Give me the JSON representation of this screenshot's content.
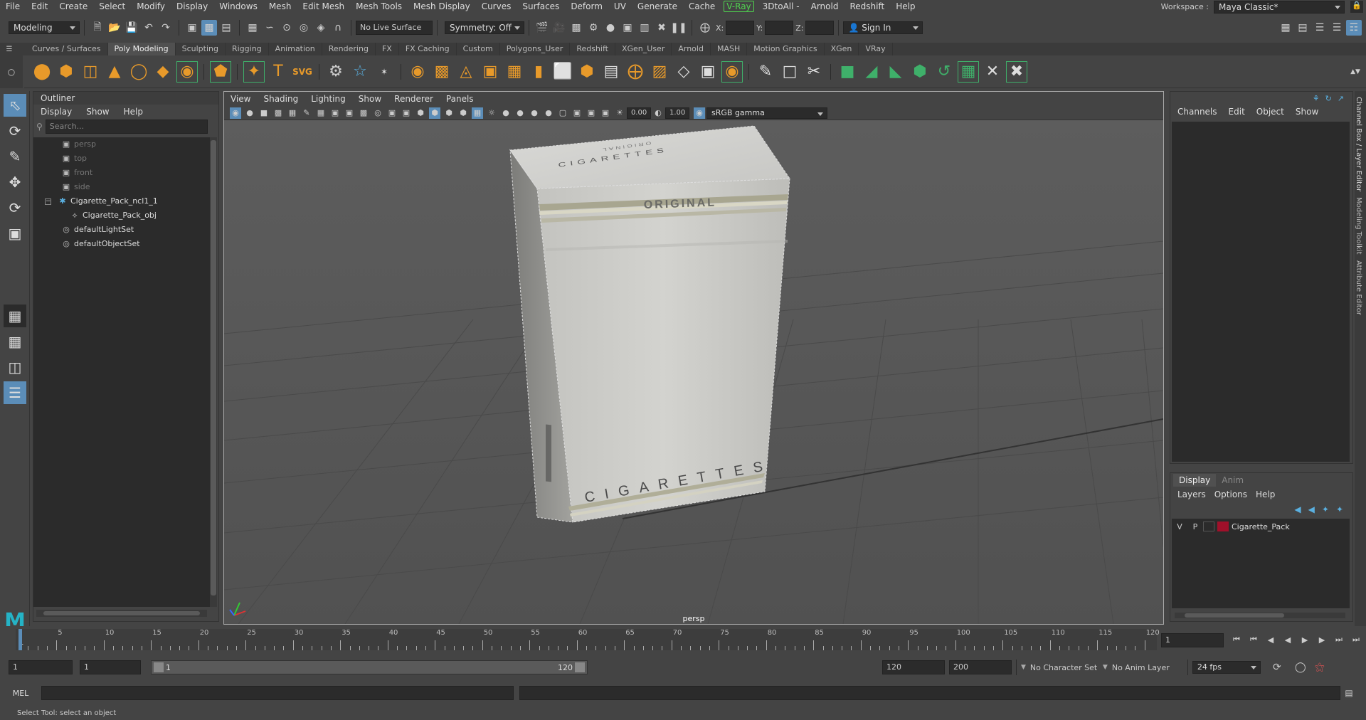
{
  "menu": [
    "File",
    "Edit",
    "Create",
    "Select",
    "Modify",
    "Display",
    "Windows",
    "Mesh",
    "Edit Mesh",
    "Mesh Tools",
    "Mesh Display",
    "Curves",
    "Surfaces",
    "Deform",
    "UV",
    "Generate",
    "Cache",
    "V-Ray",
    "3DtoAll -",
    "Arnold",
    "Redshift",
    "Help"
  ],
  "workspace": {
    "label": "Workspace :",
    "value": "Maya Classic*"
  },
  "statusline": {
    "mode": "Modeling",
    "live_surface": "No Live Surface",
    "symmetry": "Symmetry: Off",
    "x": "X:",
    "y": "Y:",
    "z": "Z:",
    "sign_in": "Sign In"
  },
  "shelf_tabs": [
    "Curves / Surfaces",
    "Poly Modeling",
    "Sculpting",
    "Rigging",
    "Animation",
    "Rendering",
    "FX",
    "FX Caching",
    "Custom",
    "Polygons_User",
    "Redshift",
    "XGen_User",
    "Arnold",
    "MASH",
    "Motion Graphics",
    "XGen",
    "VRay"
  ],
  "outliner": {
    "title": "Outliner",
    "menu": [
      "Display",
      "Show",
      "Help"
    ],
    "search_placeholder": "Search...",
    "items": [
      {
        "label": "persp",
        "icon": "camera-icon"
      },
      {
        "label": "top",
        "icon": "camera-icon"
      },
      {
        "label": "front",
        "icon": "camera-icon"
      },
      {
        "label": "side",
        "icon": "camera-icon"
      },
      {
        "label": "Cigarette_Pack_ncl1_1",
        "icon": "group-icon"
      },
      {
        "label": "Cigarette_Pack_obj",
        "icon": "mesh-icon"
      },
      {
        "label": "defaultLightSet",
        "icon": "set-icon"
      },
      {
        "label": "defaultObjectSet",
        "icon": "set-icon"
      }
    ]
  },
  "viewport": {
    "menu": [
      "View",
      "Shading",
      "Lighting",
      "Show",
      "Renderer",
      "Panels"
    ],
    "exposure": "0.00",
    "gamma": "1.00",
    "colorspace": "sRGB gamma",
    "camera_label": "persp",
    "pack_text": {
      "top": "CIGARETTES",
      "top_small": "ORIGINAL",
      "band": "ORIGINAL",
      "bottom": "CIGARETTES"
    }
  },
  "channelbox": {
    "menu": [
      "Channels",
      "Edit",
      "Object",
      "Show"
    ]
  },
  "layers": {
    "tabs": [
      "Display",
      "Anim"
    ],
    "menu": [
      "Layers",
      "Options",
      "Help"
    ],
    "row": {
      "v": "V",
      "p": "P",
      "name": "Cigarette_Pack",
      "color": "#a0102a"
    }
  },
  "sidetabs": [
    "Channel Box / Layer Editor",
    "Modeling Toolkit",
    "Attribute Editor"
  ],
  "timeline": {
    "ticks": [
      "5",
      "10",
      "15",
      "20",
      "25",
      "30",
      "35",
      "40",
      "45",
      "50",
      "55",
      "60",
      "65",
      "70",
      "75",
      "80",
      "85",
      "90",
      "95",
      "100",
      "105",
      "110",
      "115",
      "120"
    ],
    "start_tick": "1",
    "current_frame": "1"
  },
  "range": {
    "start": "1",
    "start2": "1",
    "slider_start": "1",
    "slider_end": "120",
    "end": "120",
    "end2": "200",
    "char_set": "No Character Set",
    "anim_layer": "No Anim Layer",
    "fps": "24 fps"
  },
  "cmd": {
    "label": "MEL"
  },
  "help_line": "Select Tool: select an object",
  "colors": {
    "accent": "#5b8db8",
    "vray": "#4fd64f",
    "shelf_orange": "#e89a2a",
    "shelf_green": "#3fb06a",
    "maya_logo": "#25b3c6"
  }
}
